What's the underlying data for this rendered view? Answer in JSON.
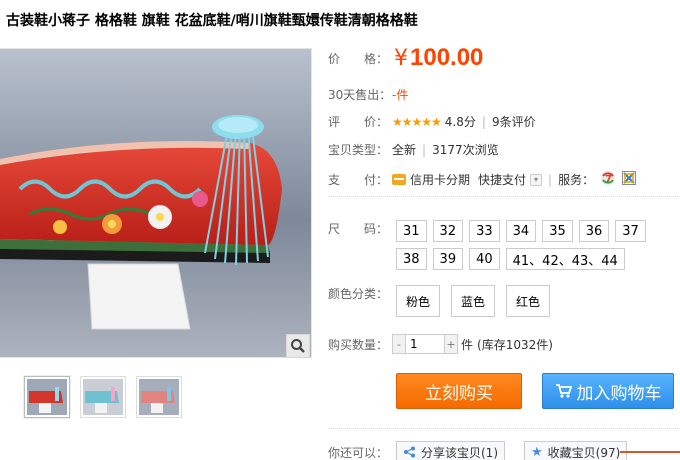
{
  "product": {
    "title": "古装鞋小蒋子 格格鞋 旗鞋 花盆底鞋/哨川旗鞋甄嬛传鞋清朝格格鞋"
  },
  "image": {
    "zoom_icon": "magnifier-icon",
    "thumbnails": [
      "thumbnail-1",
      "thumbnail-2",
      "thumbnail-3"
    ]
  },
  "price": {
    "label": "价　　格：",
    "currency": "¥",
    "value": "100.00"
  },
  "sold": {
    "label": "30天售出：",
    "value": "-件"
  },
  "rating": {
    "label": "评　　价：",
    "stars": "★★★★★",
    "score": "4.8分",
    "reviews": "9条评价",
    "score_value": 4.8
  },
  "item_type": {
    "label": "宝贝类型：",
    "type": "全新",
    "views": "3177次浏览"
  },
  "payment": {
    "label": "支　　付：",
    "credit": "信用卡分期",
    "quick": "快捷支付",
    "service_label": "服务："
  },
  "size": {
    "label": "尺　　码：",
    "options_row1": [
      "31",
      "32",
      "33",
      "34",
      "35",
      "36",
      "37"
    ],
    "options_row2": [
      "38",
      "39",
      "40",
      "41、42、43、44"
    ]
  },
  "color": {
    "label": "颜色分类：",
    "options": [
      "粉色",
      "蓝色",
      "红色"
    ]
  },
  "quantity": {
    "label": "购买数量：",
    "minus": "-",
    "value": "1",
    "plus": "+",
    "unit": "件",
    "stock": "(库存1032件)"
  },
  "actions": {
    "buy_now": "立刻购买",
    "add_cart": "加入购物车"
  },
  "share": {
    "label": "你还可以：",
    "share_item": "分享该宝贝(1)",
    "favorite": "收藏宝贝(97)"
  },
  "colors": {
    "accent": "#ff4400",
    "buy": "#f56a00",
    "cart": "#2d8fe8",
    "star": "#ff9900"
  }
}
